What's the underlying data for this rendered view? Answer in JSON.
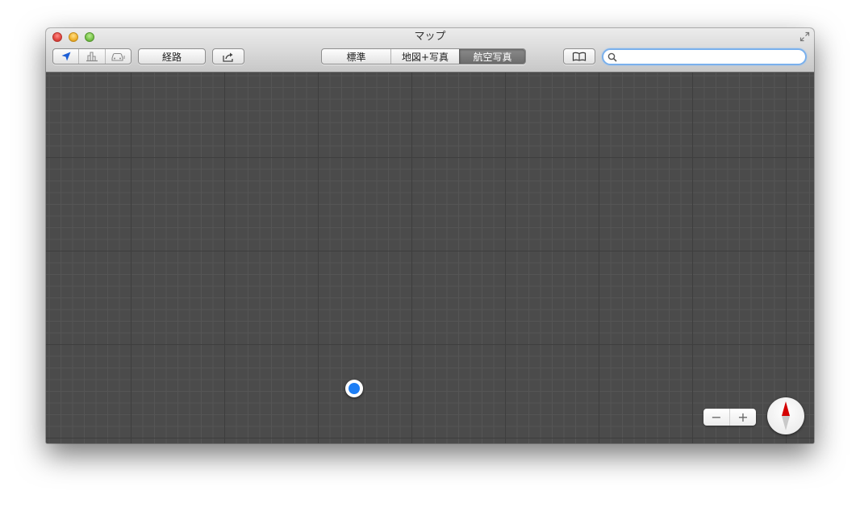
{
  "window": {
    "title": "マップ"
  },
  "toolbar": {
    "nav_group": {
      "items": [
        "location-arrow-icon",
        "3d-buildings-icon",
        "car-icon"
      ]
    },
    "route_label": "経路",
    "share_icon": "share-icon",
    "map_types": [
      {
        "label": "標準",
        "selected": false
      },
      {
        "label": "地図+写真",
        "selected": false
      },
      {
        "label": "航空写真",
        "selected": true
      }
    ],
    "bookmarks_icon": "book-icon",
    "search": {
      "value": "",
      "placeholder": ""
    }
  },
  "map": {
    "zoom_out_label": "−",
    "zoom_in_label": "+",
    "current_location_icon": "current-location-dot",
    "compass_icon": "compass-icon"
  },
  "colors": {
    "accent_blue": "#1d7ef5",
    "compass_north": "#d40000",
    "map_background": "#4b4b4b"
  }
}
